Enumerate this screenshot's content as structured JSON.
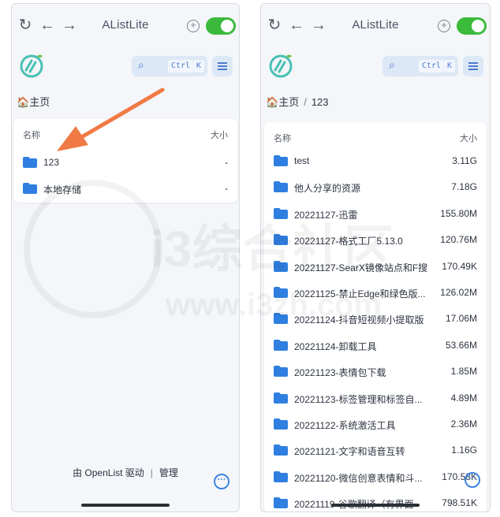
{
  "app": {
    "title": "AListLite"
  },
  "search": {
    "kbd_ctrl": "Ctrl",
    "kbd_k": "K"
  },
  "left": {
    "breadcrumb": {
      "home": "主页"
    },
    "table": {
      "col_name": "名称",
      "col_size": "大小",
      "rows": [
        {
          "name": "123",
          "size": "-"
        },
        {
          "name": "本地存储",
          "size": "-"
        }
      ]
    },
    "footer": {
      "powered": "由 OpenList 驱动",
      "manage": "管理"
    }
  },
  "right": {
    "breadcrumb": {
      "home": "主页",
      "current": "123"
    },
    "table": {
      "col_name": "名称",
      "col_size": "大小",
      "rows": [
        {
          "name": "test",
          "size": "3.11G"
        },
        {
          "name": "他人分享的资源",
          "size": "7.18G"
        },
        {
          "name": "20221127-迅雷",
          "size": "155.80M"
        },
        {
          "name": "20221127-格式工厂5.13.0",
          "size": "120.76M"
        },
        {
          "name": "20221127-SearX镜像站点和F搜",
          "size": "170.49K"
        },
        {
          "name": "20221125-禁止Edge和绿色版...",
          "size": "126.02M"
        },
        {
          "name": "20221124-抖音短视频小提取版",
          "size": "17.06M"
        },
        {
          "name": "20221124-卸载工具",
          "size": "53.66M"
        },
        {
          "name": "20221123-表情包下载",
          "size": "1.85M"
        },
        {
          "name": "20221123-标签管理和标签自...",
          "size": "4.89M"
        },
        {
          "name": "20221122-系统激活工具",
          "size": "2.36M"
        },
        {
          "name": "20221121-文字和语音互转",
          "size": "1.16G"
        },
        {
          "name": "20221120-微信创意表情和斗...",
          "size": "170.58K"
        },
        {
          "name": "20221119-谷歌翻译（有界面",
          "size": "798.51K"
        }
      ]
    }
  },
  "watermark": {
    "text": "i3综合社区",
    "url": "www.i3zh.com"
  },
  "colors": {
    "accent": "#3c84e4",
    "toggle": "#3cba3c",
    "folder": "#2f7fe0",
    "arrow": "#f07a45"
  },
  "icons": [
    "refresh-icon",
    "back-icon",
    "forward-icon",
    "plus-circle-icon",
    "toggle-switch",
    "search-icon",
    "list-icon",
    "home-icon",
    "folder-icon",
    "more-icon"
  ]
}
